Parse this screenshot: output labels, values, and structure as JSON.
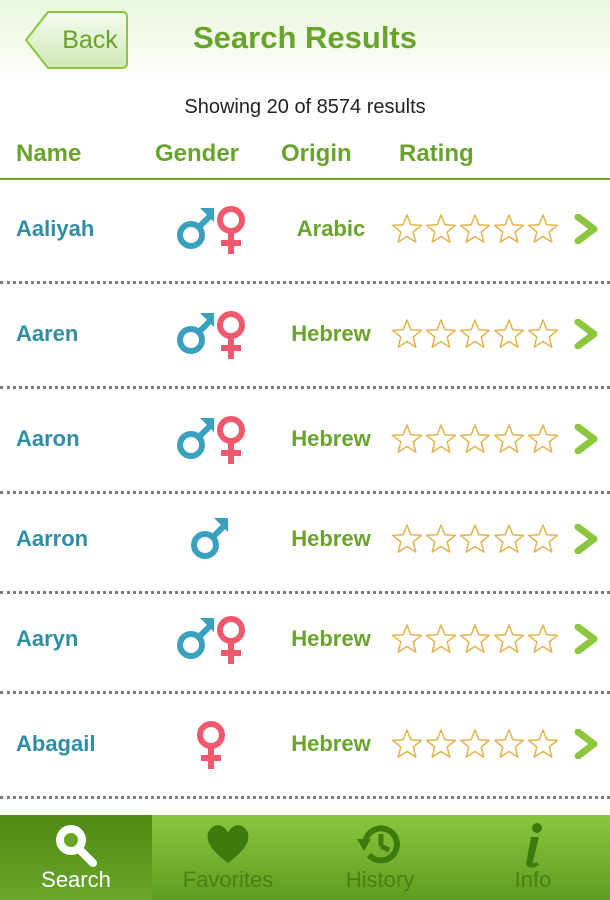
{
  "header": {
    "back_label": "Back",
    "title": "Search Results"
  },
  "summary": "Showing 20 of 8574 results",
  "columns": {
    "name": "Name",
    "gender": "Gender",
    "origin": "Origin",
    "rating": "Rating"
  },
  "colors": {
    "accent_green": "#68a42b",
    "name_blue": "#2f8ea5",
    "male_blue": "#3aa0c0",
    "female_pink": "#f0586e",
    "star_outline": "#e4b24a"
  },
  "results": [
    {
      "name": "Aaliyah",
      "gender": "unisex",
      "origin": "Arabic",
      "rating": 0
    },
    {
      "name": "Aaren",
      "gender": "unisex",
      "origin": "Hebrew",
      "rating": 0
    },
    {
      "name": "Aaron",
      "gender": "unisex",
      "origin": "Hebrew",
      "rating": 0
    },
    {
      "name": "Aarron",
      "gender": "male",
      "origin": "Hebrew",
      "rating": 0
    },
    {
      "name": "Aaryn",
      "gender": "unisex",
      "origin": "Hebrew",
      "rating": 0
    },
    {
      "name": "Abagail",
      "gender": "female",
      "origin": "Hebrew",
      "rating": 0
    }
  ],
  "tabs": [
    {
      "label": "Search",
      "icon": "search-icon",
      "active": true
    },
    {
      "label": "Favorites",
      "icon": "heart-icon",
      "active": false
    },
    {
      "label": "History",
      "icon": "history-icon",
      "active": false
    },
    {
      "label": "Info",
      "icon": "info-icon",
      "active": false
    }
  ]
}
